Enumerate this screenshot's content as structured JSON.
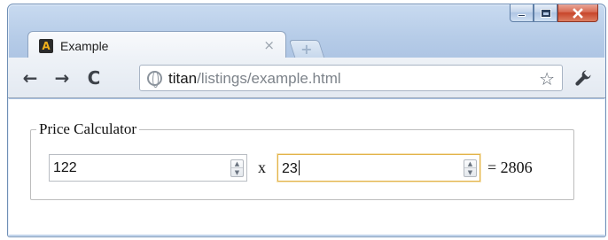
{
  "window": {
    "icons": {
      "minimize": "minimize-icon",
      "maximize": "maximize-icon",
      "close": "close-icon"
    }
  },
  "tab": {
    "favicon_letter": "A",
    "title": "Example",
    "close_glyph": "×",
    "new_tab_glyph": "+"
  },
  "toolbar": {
    "back_glyph": "←",
    "forward_glyph": "→",
    "reload_glyph": "C",
    "url_host": "titan",
    "url_path": "/listings/example.html",
    "star_glyph": "☆",
    "wrench_glyph": "🔧"
  },
  "form": {
    "legend": "Price Calculator",
    "price_value": "122",
    "multiply_label": "x",
    "quantity_value": "23",
    "result_label": "= 2806",
    "spin_up_glyph": "▲",
    "spin_down_glyph": "▼"
  },
  "colors": {
    "focus_border": "#e2b34a",
    "window_frame": "#b5cbe7",
    "close_button": "#c7452a"
  }
}
